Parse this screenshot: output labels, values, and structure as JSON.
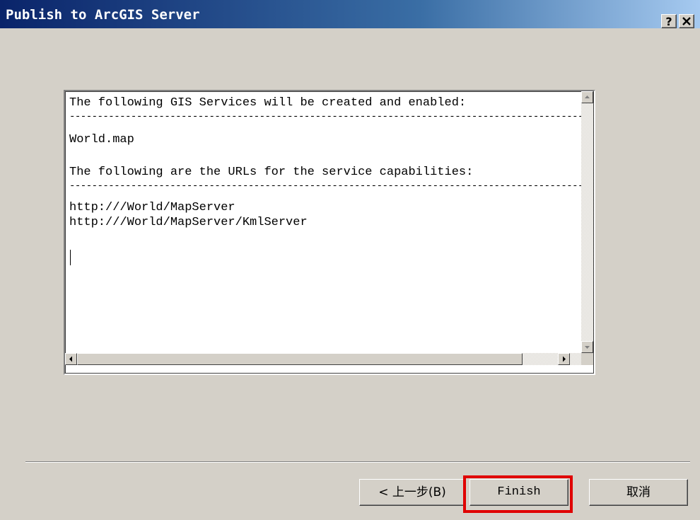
{
  "window": {
    "title": "Publish to ArcGIS Server",
    "help_label": "?",
    "close_label": "✕"
  },
  "output": {
    "line1": "The following GIS Services will be created and enabled:",
    "separator": "------------------------------------------------------------------------------------------------------------------------------------------",
    "line2": "World.map",
    "line3": "The following are the URLs for the service capabilities:",
    "line4": "http:///World/MapServer",
    "line5": "http:///World/MapServer/KmlServer"
  },
  "buttons": {
    "back": "< 上一步(B)",
    "finish": "Finish",
    "cancel": "取消"
  },
  "highlight_color": "#e00000"
}
